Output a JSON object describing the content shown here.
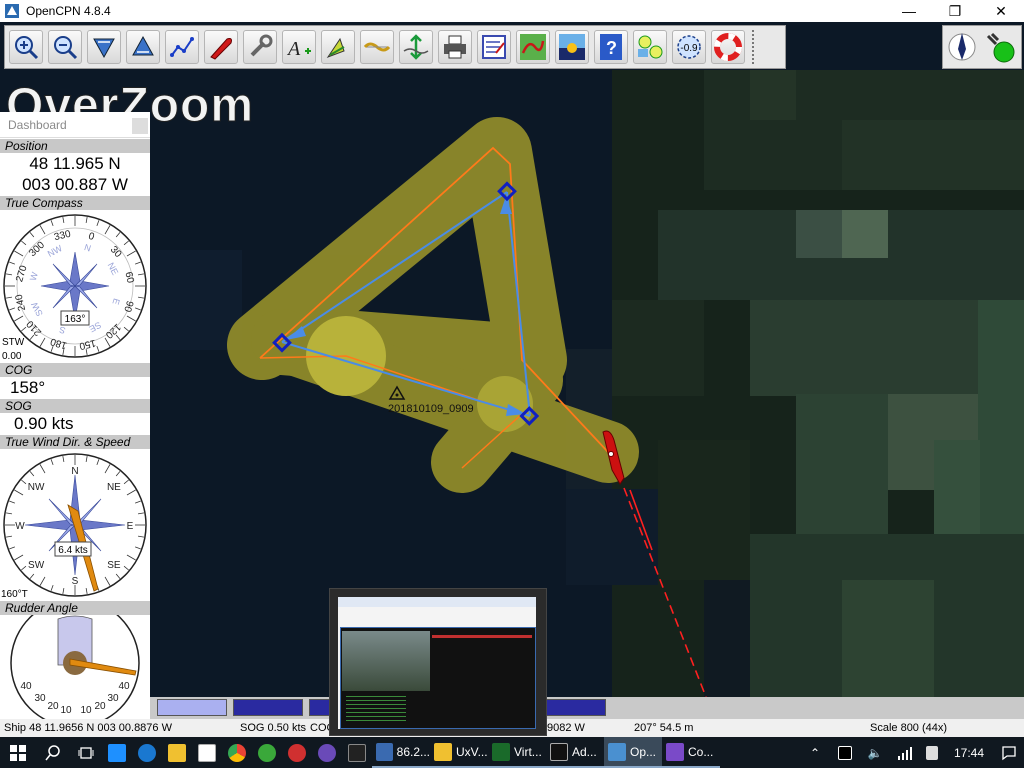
{
  "window": {
    "title": "OpenCPN 4.8.4"
  },
  "toolbar": {
    "buttons": [
      {
        "name": "zoom-in-icon"
      },
      {
        "name": "zoom-out-icon"
      },
      {
        "name": "scale-down-icon"
      },
      {
        "name": "scale-up-icon"
      },
      {
        "name": "route-icon"
      },
      {
        "name": "auto-follow-icon"
      },
      {
        "name": "settings-icon"
      },
      {
        "name": "text-icon"
      },
      {
        "name": "current-icon"
      },
      {
        "name": "tide-icon"
      },
      {
        "name": "tide-level-icon"
      },
      {
        "name": "print-icon"
      },
      {
        "name": "route-manager-icon"
      },
      {
        "name": "track-icon"
      },
      {
        "name": "color-scheme-icon"
      },
      {
        "name": "help-icon"
      },
      {
        "name": "dashboard-icon"
      },
      {
        "name": "rotation-icon"
      },
      {
        "name": "mob-icon"
      }
    ],
    "rotation_value": "-0.9"
  },
  "chart": {
    "overlay_text": "OverZoom",
    "waypoint_label": "201810109_0909"
  },
  "dashboard": {
    "title": "Dashboard",
    "position": {
      "caption": "Position",
      "lat": "48 11.965 N",
      "lon": "003 00.887 W"
    },
    "compass": {
      "caption": "True Compass",
      "heading": "163°",
      "stw_label": "STW",
      "stw_value": "0.00",
      "labels": [
        "150",
        "180",
        "210",
        "240",
        "270",
        "300",
        "330",
        "0",
        "30",
        "60",
        "90",
        "120"
      ],
      "cardinals": [
        "SE",
        "S",
        "SW",
        "W",
        "NW",
        "N",
        "NE",
        "E"
      ]
    },
    "cog": {
      "caption": "COG",
      "value": "158°"
    },
    "sog": {
      "caption": "SOG",
      "value": "0.90 kts"
    },
    "wind": {
      "caption": "True Wind Dir. & Speed",
      "speed": "6.4 kts",
      "direction": "160°T",
      "cardinals": [
        "N",
        "NE",
        "E",
        "SE",
        "S",
        "SW",
        "W",
        "NW"
      ]
    },
    "rudder": {
      "caption": "Rudder Angle",
      "labels_left": [
        "40",
        "30",
        "20",
        "10"
      ],
      "labels_right": [
        "10",
        "20",
        "30",
        "40"
      ]
    }
  },
  "statusbar": {
    "ship": "Ship 48 11.9656 N   003 00.8876 W",
    "sog": "SOG 0.50 kts",
    "cog": "COG",
    "cursor": "9082 W",
    "bearing": "207°  54.5 m",
    "scale": "Scale  800 (44x)"
  },
  "taskbar": {
    "apps": [
      {
        "label": "86.2...",
        "icon": "window-icon"
      },
      {
        "label": "UxV...",
        "icon": "folder-icon"
      },
      {
        "label": "Virt...",
        "icon": "terminal-icon"
      },
      {
        "label": "Ad...",
        "icon": "cmd-icon"
      },
      {
        "label": "Op...",
        "icon": "opencpn-icon"
      },
      {
        "label": "Co...",
        "icon": "vs-icon"
      }
    ],
    "time": "17:44"
  }
}
